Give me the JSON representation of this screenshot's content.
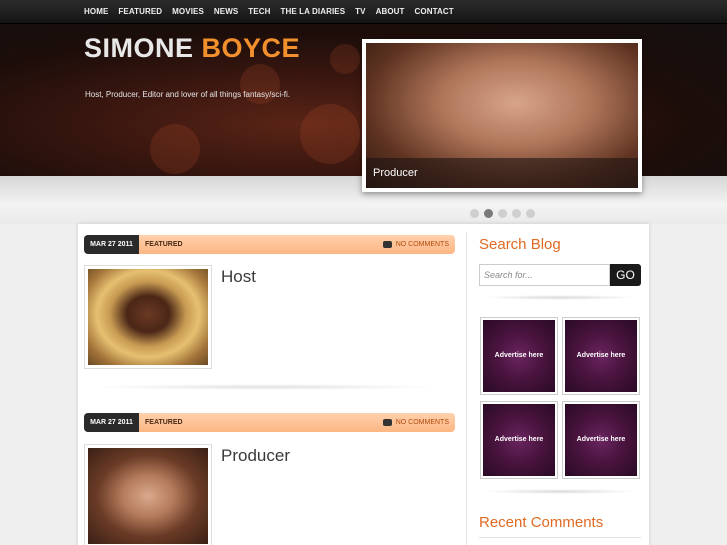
{
  "nav": {
    "items": [
      "HOME",
      "FEATURED",
      "MOVIES",
      "NEWS",
      "TECH",
      "THE LA DIARIES",
      "TV",
      "ABOUT",
      "CONTACT"
    ]
  },
  "site": {
    "title_first": "SIMONE",
    "title_second": "BOYCE",
    "tagline": "Host, Producer, Editor and lover of all things fantasy/sci-fi."
  },
  "slider": {
    "caption": "Producer",
    "dot_count": 5,
    "active_dot": 2
  },
  "posts": [
    {
      "date": "MAR 27 2011",
      "category": "FEATURED",
      "comments": "NO COMMENTS",
      "title": "Host"
    },
    {
      "date": "MAR 27 2011",
      "category": "FEATURED",
      "comments": "NO COMMENTS",
      "title": "Producer"
    }
  ],
  "sidebar": {
    "search_heading": "Search Blog",
    "search_placeholder": "Search for...",
    "search_button": "GO",
    "ads": [
      "Advertise here",
      "Advertise here",
      "Advertise here",
      "Advertise here"
    ],
    "recent_heading": "Recent Comments"
  },
  "colors": {
    "accent": "#f3902e",
    "heading": "#e06a21",
    "meta_bar": "#fcb683",
    "ad_bg": "#4a143f"
  }
}
